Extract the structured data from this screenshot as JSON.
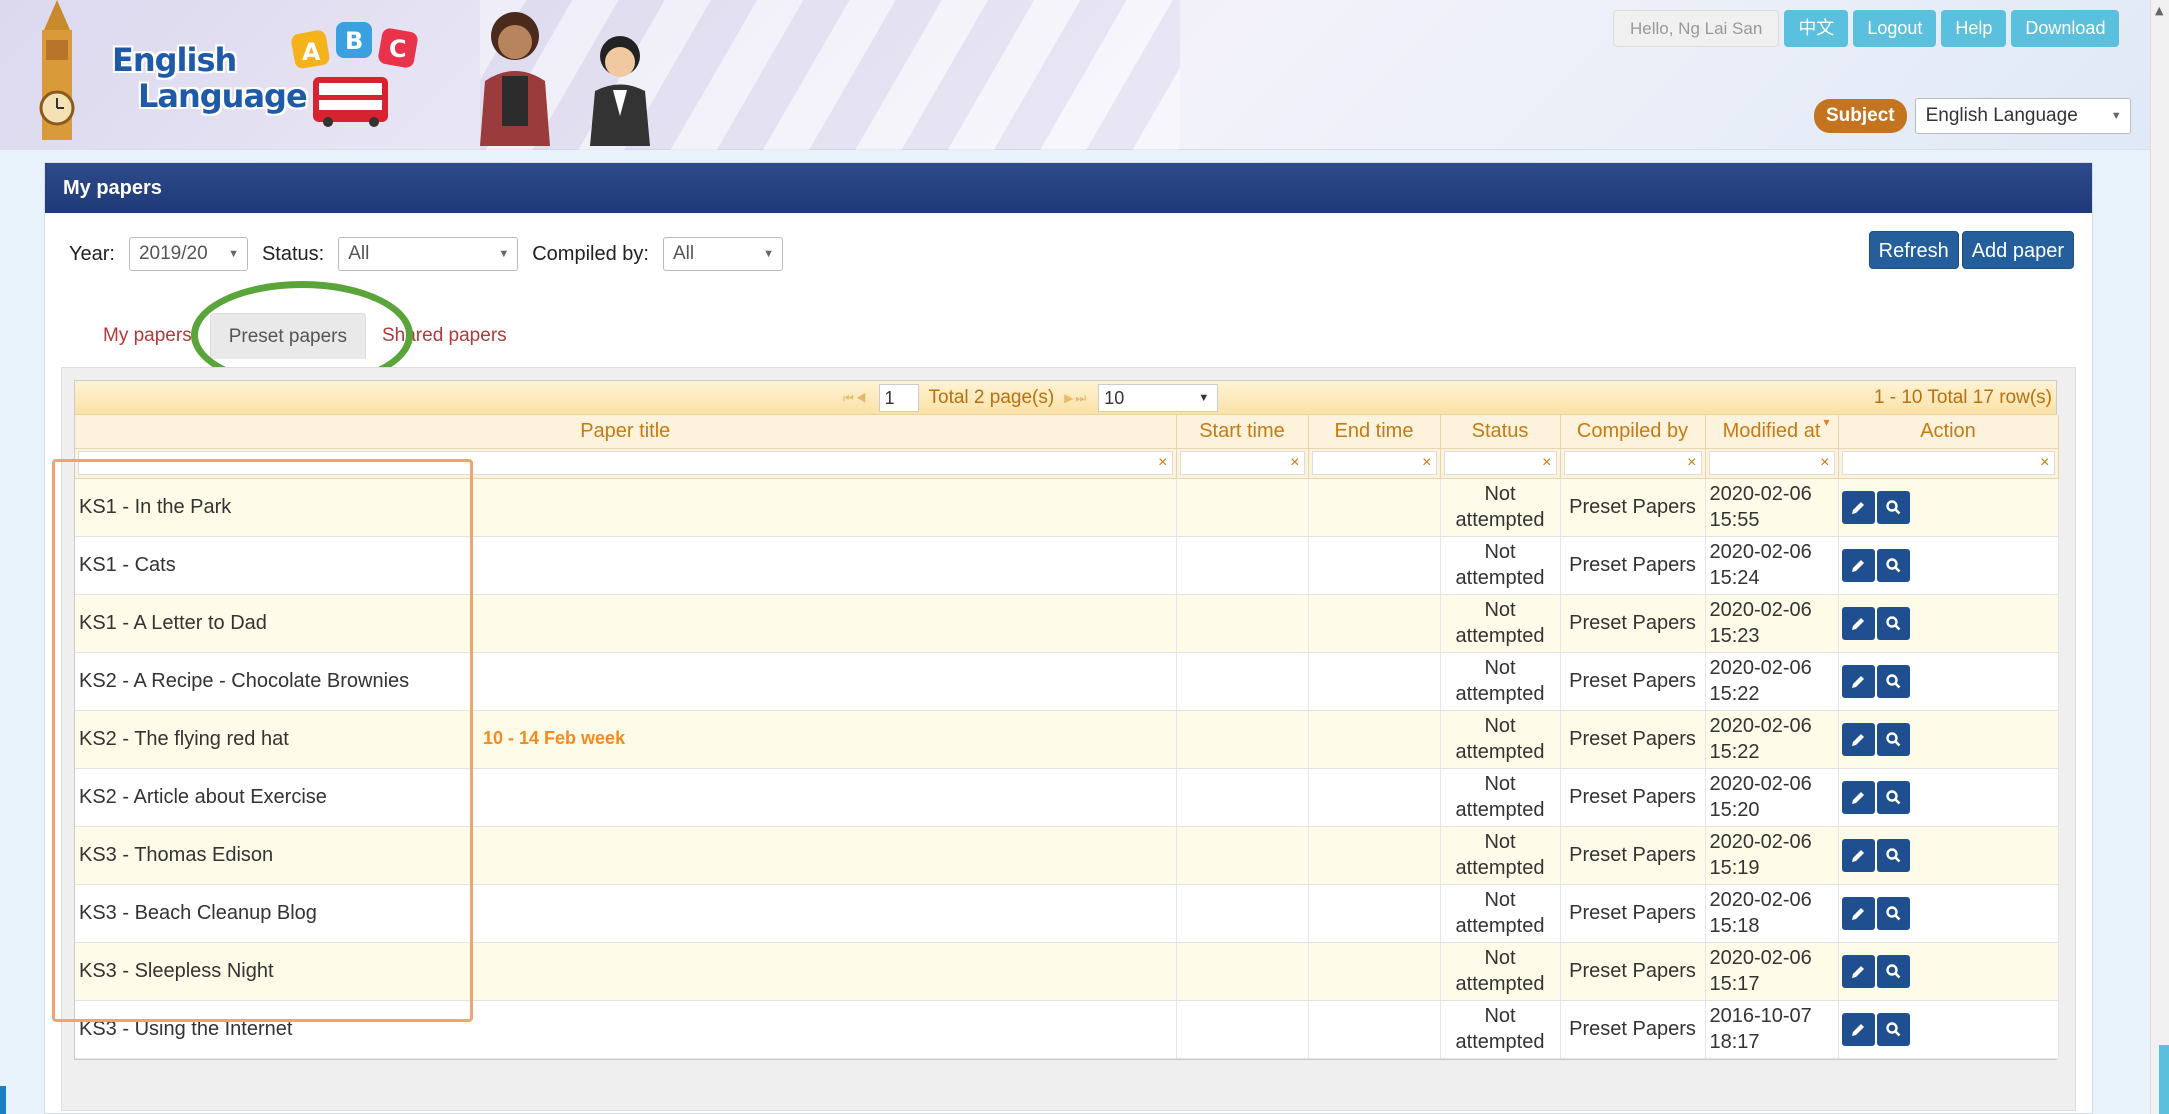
{
  "header": {
    "logo_line1": "English",
    "logo_line2": "Language",
    "greeting": "Hello, Ng Lai San",
    "buttons": [
      "中文",
      "Logout",
      "Help",
      "Download"
    ],
    "subject_label": "Subject",
    "subject_value": "English Language"
  },
  "panel": {
    "title": "My papers",
    "year_label": "Year:",
    "year_value": "2019/20",
    "status_label": "Status:",
    "status_value": "All",
    "compiled_label": "Compiled by:",
    "compiled_value": "All",
    "refresh_label": "Refresh",
    "add_label": "Add paper"
  },
  "tabs": [
    "My papers",
    "Preset papers",
    "Shared papers"
  ],
  "pager": {
    "page": "1",
    "total_pages": "Total 2 page(s)",
    "page_size": "10",
    "summary": "1 - 10 Total 17 row(s)"
  },
  "columns": [
    "Paper title",
    "Start time",
    "End time",
    "Status",
    "Compiled by",
    "Modified at",
    "Action"
  ],
  "note": "10 - 14 Feb week",
  "rows": [
    {
      "title": "KS1 - In the Park",
      "status1": "Not",
      "status2": "attempted",
      "compiled": "Preset Papers",
      "date": "2020-02-06",
      "time": "15:55"
    },
    {
      "title": "KS1 - Cats",
      "status1": "Not",
      "status2": "attempted",
      "compiled": "Preset Papers",
      "date": "2020-02-06",
      "time": "15:24"
    },
    {
      "title": "KS1 - A Letter to Dad",
      "status1": "Not",
      "status2": "attempted",
      "compiled": "Preset Papers",
      "date": "2020-02-06",
      "time": "15:23"
    },
    {
      "title": "KS2 - A Recipe - Chocolate Brownies",
      "status1": "Not",
      "status2": "attempted",
      "compiled": "Preset Papers",
      "date": "2020-02-06",
      "time": "15:22"
    },
    {
      "title": "KS2 - The flying red hat",
      "status1": "Not",
      "status2": "attempted",
      "compiled": "Preset Papers",
      "date": "2020-02-06",
      "time": "15:22"
    },
    {
      "title": "KS2 - Article about Exercise",
      "status1": "Not",
      "status2": "attempted",
      "compiled": "Preset Papers",
      "date": "2020-02-06",
      "time": "15:20"
    },
    {
      "title": "KS3 - Thomas Edison",
      "status1": "Not",
      "status2": "attempted",
      "compiled": "Preset Papers",
      "date": "2020-02-06",
      "time": "15:19"
    },
    {
      "title": "KS3 - Beach Cleanup Blog",
      "status1": "Not",
      "status2": "attempted",
      "compiled": "Preset Papers",
      "date": "2020-02-06",
      "time": "15:18"
    },
    {
      "title": "KS3 - Sleepless Night",
      "status1": "Not",
      "status2": "attempted",
      "compiled": "Preset Papers",
      "date": "2020-02-06",
      "time": "15:17"
    },
    {
      "title": "KS3 - Using the Internet",
      "status1": "Not",
      "status2": "attempted",
      "compiled": "Preset Papers",
      "date": "2016-10-07",
      "time": "18:17"
    }
  ],
  "colors": {
    "panel_head": "#203a78",
    "accent_button": "#5bc0de",
    "action_button": "#1f4f8f",
    "highlight_circle": "#5aa53a",
    "highlight_box": "#f4a46a",
    "note_text": "#f58b1f"
  }
}
